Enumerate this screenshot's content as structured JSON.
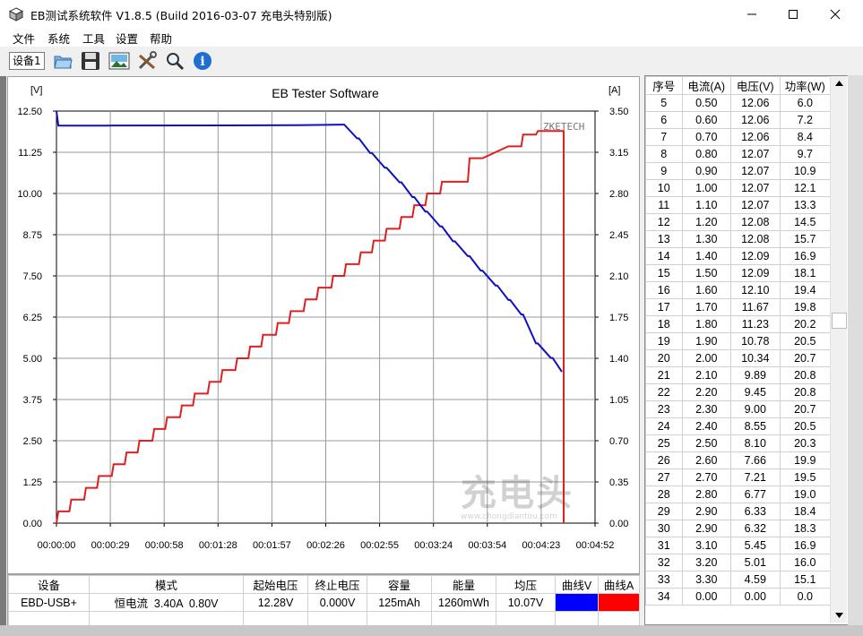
{
  "window": {
    "title": "EB测试系统软件 V1.8.5 (Build 2016-03-07 充电头特别版)"
  },
  "menu": [
    "文件",
    "系统",
    "工具",
    "设置",
    "帮助"
  ],
  "toolbar": {
    "device_tab": "设备1",
    "buttons": [
      "open-folder-icon",
      "save-icon",
      "image-icon",
      "tools-icon",
      "search-icon",
      "info-icon"
    ]
  },
  "chart_data": {
    "type": "line",
    "title": "EB Tester Software",
    "left_unit": "[V]",
    "right_unit": "[A]",
    "watermark": "ZKETECH",
    "y_left_ticks": [
      "12.50",
      "11.25",
      "10.00",
      "8.75",
      "7.50",
      "6.25",
      "5.00",
      "3.75",
      "2.50",
      "1.25",
      "0.00"
    ],
    "y_right_ticks": [
      "3.50",
      "3.15",
      "2.80",
      "2.45",
      "2.10",
      "1.75",
      "1.40",
      "1.05",
      "0.70",
      "0.35",
      "0.00"
    ],
    "x_ticks": [
      "00:00:00",
      "00:00:29",
      "00:00:58",
      "00:01:28",
      "00:01:57",
      "00:02:26",
      "00:02:55",
      "00:03:24",
      "00:03:54",
      "00:04:23",
      "00:04:52"
    ],
    "ylim_left": [
      0,
      12.5
    ],
    "ylim_right": [
      0,
      3.5
    ],
    "xlim_seconds": [
      0,
      292
    ],
    "voltage_color": "#0000ff",
    "current_color": "#ff0000",
    "voltage_series": {
      "t": [
        0,
        1,
        1,
        25,
        27,
        130,
        131,
        155,
        156,
        163,
        164,
        170,
        171,
        178,
        179,
        186,
        187,
        193,
        194,
        200,
        201,
        208,
        209,
        215,
        216,
        223,
        224,
        230,
        231,
        238,
        239,
        245,
        246,
        252,
        253,
        260,
        261,
        268,
        269,
        274
      ],
      "v": [
        12.9,
        12.06,
        12.06,
        12.06,
        12.06,
        12.07,
        12.07,
        12.09,
        12.09,
        11.67,
        11.67,
        11.23,
        11.23,
        10.78,
        10.78,
        10.34,
        10.34,
        9.89,
        9.89,
        9.45,
        9.45,
        9.0,
        9.0,
        8.55,
        8.55,
        8.1,
        8.1,
        7.66,
        7.66,
        7.21,
        7.21,
        6.77,
        6.77,
        6.33,
        6.33,
        5.45,
        5.45,
        5.01,
        5.01,
        4.59
      ]
    },
    "current_series": {
      "t": [
        0,
        1,
        7,
        8,
        15,
        16,
        22,
        23,
        30,
        31,
        37,
        38,
        44,
        45,
        52,
        53,
        59,
        60,
        67,
        68,
        74,
        75,
        82,
        83,
        89,
        90,
        97,
        98,
        104,
        105,
        111,
        112,
        119,
        120,
        126,
        127,
        134,
        135,
        141,
        142,
        149,
        150,
        156,
        157,
        164,
        165,
        171,
        172,
        178,
        179,
        186,
        187,
        193,
        194,
        200,
        201,
        208,
        209,
        215,
        216,
        223,
        224,
        230,
        231,
        245,
        246,
        252,
        253,
        260,
        261,
        268,
        269,
        275,
        275
      ],
      "a": [
        0,
        0.1,
        0.1,
        0.2,
        0.2,
        0.3,
        0.3,
        0.4,
        0.4,
        0.5,
        0.5,
        0.6,
        0.6,
        0.7,
        0.7,
        0.8,
        0.8,
        0.9,
        0.9,
        1.0,
        1.0,
        1.1,
        1.1,
        1.2,
        1.2,
        1.3,
        1.3,
        1.4,
        1.4,
        1.5,
        1.5,
        1.6,
        1.6,
        1.7,
        1.7,
        1.8,
        1.8,
        1.9,
        1.9,
        2.0,
        2.0,
        2.1,
        2.1,
        2.2,
        2.2,
        2.3,
        2.3,
        2.4,
        2.4,
        2.5,
        2.5,
        2.6,
        2.6,
        2.7,
        2.7,
        2.8,
        2.8,
        2.9,
        2.9,
        2.9,
        2.9,
        3.1,
        3.1,
        3.1,
        3.2,
        3.2,
        3.2,
        3.3,
        3.3,
        3.33,
        3.33,
        3.33,
        3.33,
        0
      ]
    }
  },
  "data_grid": {
    "headers": [
      "序号",
      "电流(A)",
      "电压(V)",
      "功率(W)"
    ],
    "rows": [
      [
        "5",
        "0.50",
        "12.06",
        "6.0"
      ],
      [
        "6",
        "0.60",
        "12.06",
        "7.2"
      ],
      [
        "7",
        "0.70",
        "12.06",
        "8.4"
      ],
      [
        "8",
        "0.80",
        "12.07",
        "9.7"
      ],
      [
        "9",
        "0.90",
        "12.07",
        "10.9"
      ],
      [
        "10",
        "1.00",
        "12.07",
        "12.1"
      ],
      [
        "11",
        "1.10",
        "12.07",
        "13.3"
      ],
      [
        "12",
        "1.20",
        "12.08",
        "14.5"
      ],
      [
        "13",
        "1.30",
        "12.08",
        "15.7"
      ],
      [
        "14",
        "1.40",
        "12.09",
        "16.9"
      ],
      [
        "15",
        "1.50",
        "12.09",
        "18.1"
      ],
      [
        "16",
        "1.60",
        "12.10",
        "19.4"
      ],
      [
        "17",
        "1.70",
        "11.67",
        "19.8"
      ],
      [
        "18",
        "1.80",
        "11.23",
        "20.2"
      ],
      [
        "19",
        "1.90",
        "10.78",
        "20.5"
      ],
      [
        "20",
        "2.00",
        "10.34",
        "20.7"
      ],
      [
        "21",
        "2.10",
        "9.89",
        "20.8"
      ],
      [
        "22",
        "2.20",
        "9.45",
        "20.8"
      ],
      [
        "23",
        "2.30",
        "9.00",
        "20.7"
      ],
      [
        "24",
        "2.40",
        "8.55",
        "20.5"
      ],
      [
        "25",
        "2.50",
        "8.10",
        "20.3"
      ],
      [
        "26",
        "2.60",
        "7.66",
        "19.9"
      ],
      [
        "27",
        "2.70",
        "7.21",
        "19.5"
      ],
      [
        "28",
        "2.80",
        "6.77",
        "19.0"
      ],
      [
        "29",
        "2.90",
        "6.33",
        "18.4"
      ],
      [
        "30",
        "2.90",
        "6.32",
        "18.3"
      ],
      [
        "31",
        "3.10",
        "5.45",
        "16.9"
      ],
      [
        "32",
        "3.20",
        "5.01",
        "16.0"
      ],
      [
        "33",
        "3.30",
        "4.59",
        "15.1"
      ],
      [
        "34",
        "0.00",
        "0.00",
        "0.0"
      ]
    ]
  },
  "info_table": {
    "headers": [
      "设备",
      "模式",
      "起始电压",
      "终止电压",
      "容量",
      "能量",
      "均压",
      "曲线V",
      "曲线A"
    ],
    "row": [
      "EBD-USB+",
      "恒电流  3.40A  0.80V",
      "12.28V",
      "0.000V",
      "125mAh",
      "1260mWh",
      "10.07V",
      "",
      ""
    ],
    "curve_v_color": "#0000ff",
    "curve_a_color": "#ff0000"
  }
}
